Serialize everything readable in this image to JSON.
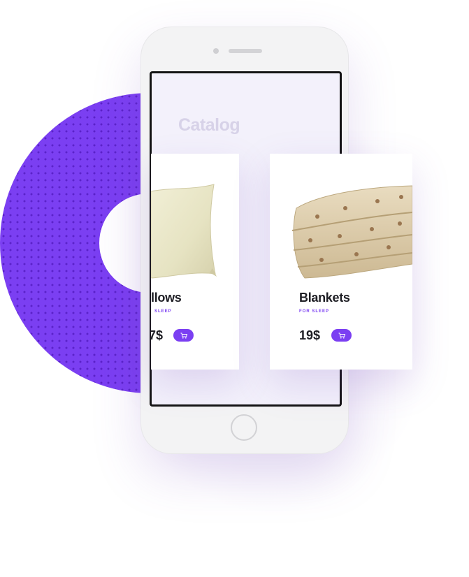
{
  "screen": {
    "title": "Catalog"
  },
  "products": [
    {
      "name": "llows",
      "subtitle": "SLEEP",
      "price": "7$",
      "cart_icon": "cart-icon"
    },
    {
      "name": "Blankets",
      "subtitle": "FOR SLEEP",
      "price": "19$",
      "cart_icon": "cart-icon"
    }
  ],
  "colors": {
    "accent": "#7b3ff2",
    "dots": "#5a22c9",
    "title_faded": "#d7d2e8",
    "text": "#1e1e24",
    "phone_body": "#f3f3f4"
  }
}
